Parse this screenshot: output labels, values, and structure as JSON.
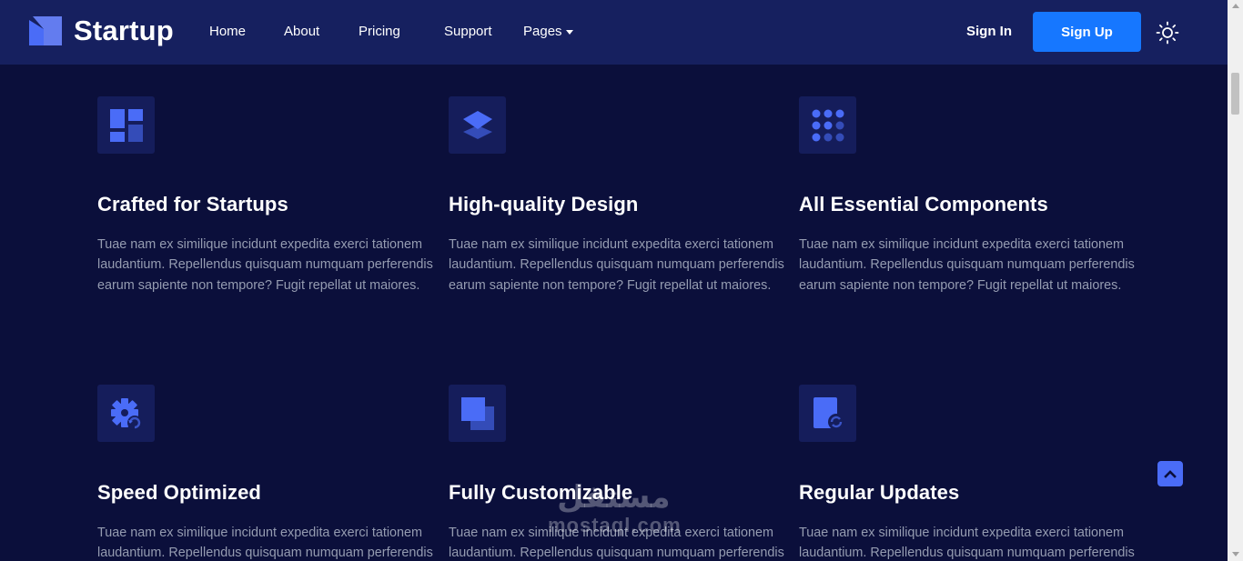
{
  "brand": {
    "name": "Startup",
    "icon": "startup-logo-icon"
  },
  "nav": {
    "home": "Home",
    "about": "About",
    "pricing": "Pricing",
    "support": "Support",
    "pages": "Pages",
    "sign_in": "Sign In",
    "sign_up": "Sign Up",
    "theme_icon": "sun-icon"
  },
  "features": [
    {
      "icon": "layout-grid-icon",
      "title": "Crafted for Startups",
      "text": "Tuae nam ex similique incidunt expedita exerci tationem laudantium. Repellendus quisquam numquam perferendis earum sapiente non tempore? Fugit repellat ut maiores."
    },
    {
      "icon": "layers-icon",
      "title": "High-quality Design",
      "text": "Tuae nam ex similique incidunt expedita exerci tationem laudantium. Repellendus quisquam numquam perferendis earum sapiente non tempore? Fugit repellat ut maiores."
    },
    {
      "icon": "dots-grid-icon",
      "title": "All Essential Components",
      "text": "Tuae nam ex similique incidunt expedita exerci tationem laudantium. Repellendus quisquam numquam perferendis earum sapiente non tempore? Fugit repellat ut maiores."
    },
    {
      "icon": "gear-refresh-icon",
      "title": "Speed Optimized",
      "text": "Tuae nam ex similique incidunt expedita exerci tationem laudantium. Repellendus quisquam numquam perferendis earum sapiente non tempore? Fugit repellat ut maiores."
    },
    {
      "icon": "stacked-squares-icon",
      "title": "Fully Customizable",
      "text": "Tuae nam ex similique incidunt expedita exerci tationem laudantium. Repellendus quisquam numquam perferendis earum sapiente non tempore? Fugit repellat ut maiores."
    },
    {
      "icon": "document-sync-icon",
      "title": "Regular Updates",
      "text": "Tuae nam ex similique incidunt expedita exerci tationem laudantium. Repellendus quisquam numquam perferendis earum sapiente non tempore? Fugit repellat ut maiores."
    }
  ],
  "back_to_top_icon": "chevron-up-icon",
  "watermark": {
    "arabic": "مستقل",
    "latin": "mostaql.com"
  },
  "colors": {
    "background": "#0b0f3b",
    "navbar": "#16205f",
    "primary": "#1677ff",
    "accent": "#4a6cf7",
    "icon_box": "#151d5b",
    "body_text": "#959cb1"
  }
}
